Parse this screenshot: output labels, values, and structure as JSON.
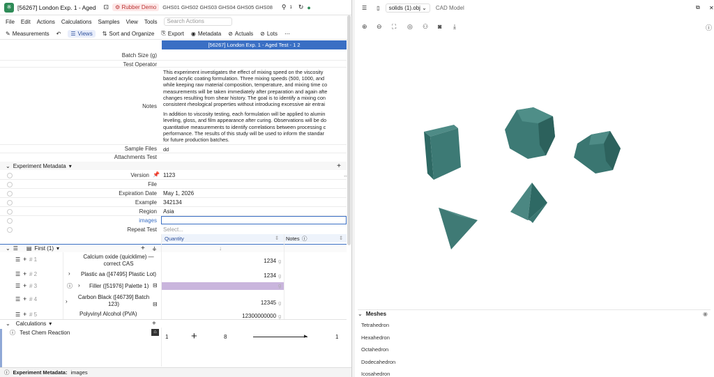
{
  "window": {
    "title": "[56267] London Exp. 1 - Aged",
    "tag": "Rubber Demo",
    "ghs": [
      "GHS01",
      "GHS02",
      "GHS03",
      "GHS04",
      "GHS05",
      "GHS08"
    ],
    "badge_count": "1"
  },
  "menu": {
    "items": [
      "File",
      "Edit",
      "Actions",
      "Calculations",
      "Samples",
      "View",
      "Tools"
    ],
    "search_placeholder": "Search Actions"
  },
  "toolbar": {
    "measurements": "Measurements",
    "views": "Views",
    "sort": "Sort and Organize",
    "export": "Export",
    "metadata": "Metadata",
    "actuals": "Actuals",
    "lots": "Lots"
  },
  "banner": "[56267] London Exp. 1 - Aged Test - 1 2",
  "fields": {
    "batch_size": "Batch Size (g)",
    "test_operator": "Test Operator",
    "notes_label": "Notes",
    "notes_p1": [
      "This experiment investigates the effect of mixing speed on the viscosity",
      "based acrylic coating formulation. Three mixing speeds (500, 1000, and",
      "while keeping raw material composition, temperature, and mixing time co",
      "measurements will be taken immediately after preparation and again afte",
      "changes resulting from shear history. The goal is to identify a mixing con",
      "consistent rheological properties without introducing excessive air entrai"
    ],
    "notes_p2": [
      "In addition to viscosity testing, each formulation will be applied to alumin",
      "leveling, gloss, and film appearance after curing. Observations will be do",
      "quantitative measurements to identify correlations between processing c",
      "performance. The results of this study will be used to inform the standar",
      "for future production batches."
    ],
    "notes_p3": "dd",
    "sample_files": "Sample Files",
    "attachments": "Attachments Test"
  },
  "metadata": {
    "header": "Experiment Metadata",
    "rows": [
      {
        "label": "Version",
        "value": "1123"
      },
      {
        "label": "File",
        "value": ""
      },
      {
        "label": "Expiration Date",
        "value": "May 1, 2026"
      },
      {
        "label": "Example",
        "value": "342134"
      },
      {
        "label": "Region",
        "value": "Asia"
      },
      {
        "label": "images",
        "value": ""
      },
      {
        "label": "Repeat Test",
        "value": "Select..."
      }
    ]
  },
  "grid": {
    "group": "First (1)",
    "col_quantity": "Quantity",
    "col_notes": "Notes",
    "rows": [
      {
        "num": "# 1",
        "name": "Calcium oxide (quicklime) — correct CAS",
        "qty": "1234",
        "unit": "g"
      },
      {
        "num": "# 2",
        "name": "Plastic aa ([47495] Plastic Lot)",
        "qty": "1234",
        "unit": "g"
      },
      {
        "num": "# 3",
        "name": "Filler ([51976] Palette 1)",
        "qty": "",
        "unit": "g"
      },
      {
        "num": "# 4",
        "name": "Carbon Black ([46739] Batch 123)",
        "qty": "12345",
        "unit": "g"
      },
      {
        "num": "# 5",
        "name": "Polyvinyl Alcohol (PVA)",
        "qty": "12300000000",
        "unit": "g"
      }
    ]
  },
  "calculations": {
    "header": "Calculations",
    "item": "Test Chem Reaction",
    "values": [
      "1",
      "8",
      "1"
    ]
  },
  "status": {
    "label": "Experiment Metadata:",
    "value": "images"
  },
  "viewer": {
    "file": "solids (1).obj",
    "type": "CAD Model",
    "meshes_header": "Meshes",
    "meshes": [
      "Tetrahedron",
      "Hexahedron",
      "Octahedron",
      "Dodecahedron",
      "Icosahedron"
    ],
    "solid_color": "#3f7a75"
  }
}
